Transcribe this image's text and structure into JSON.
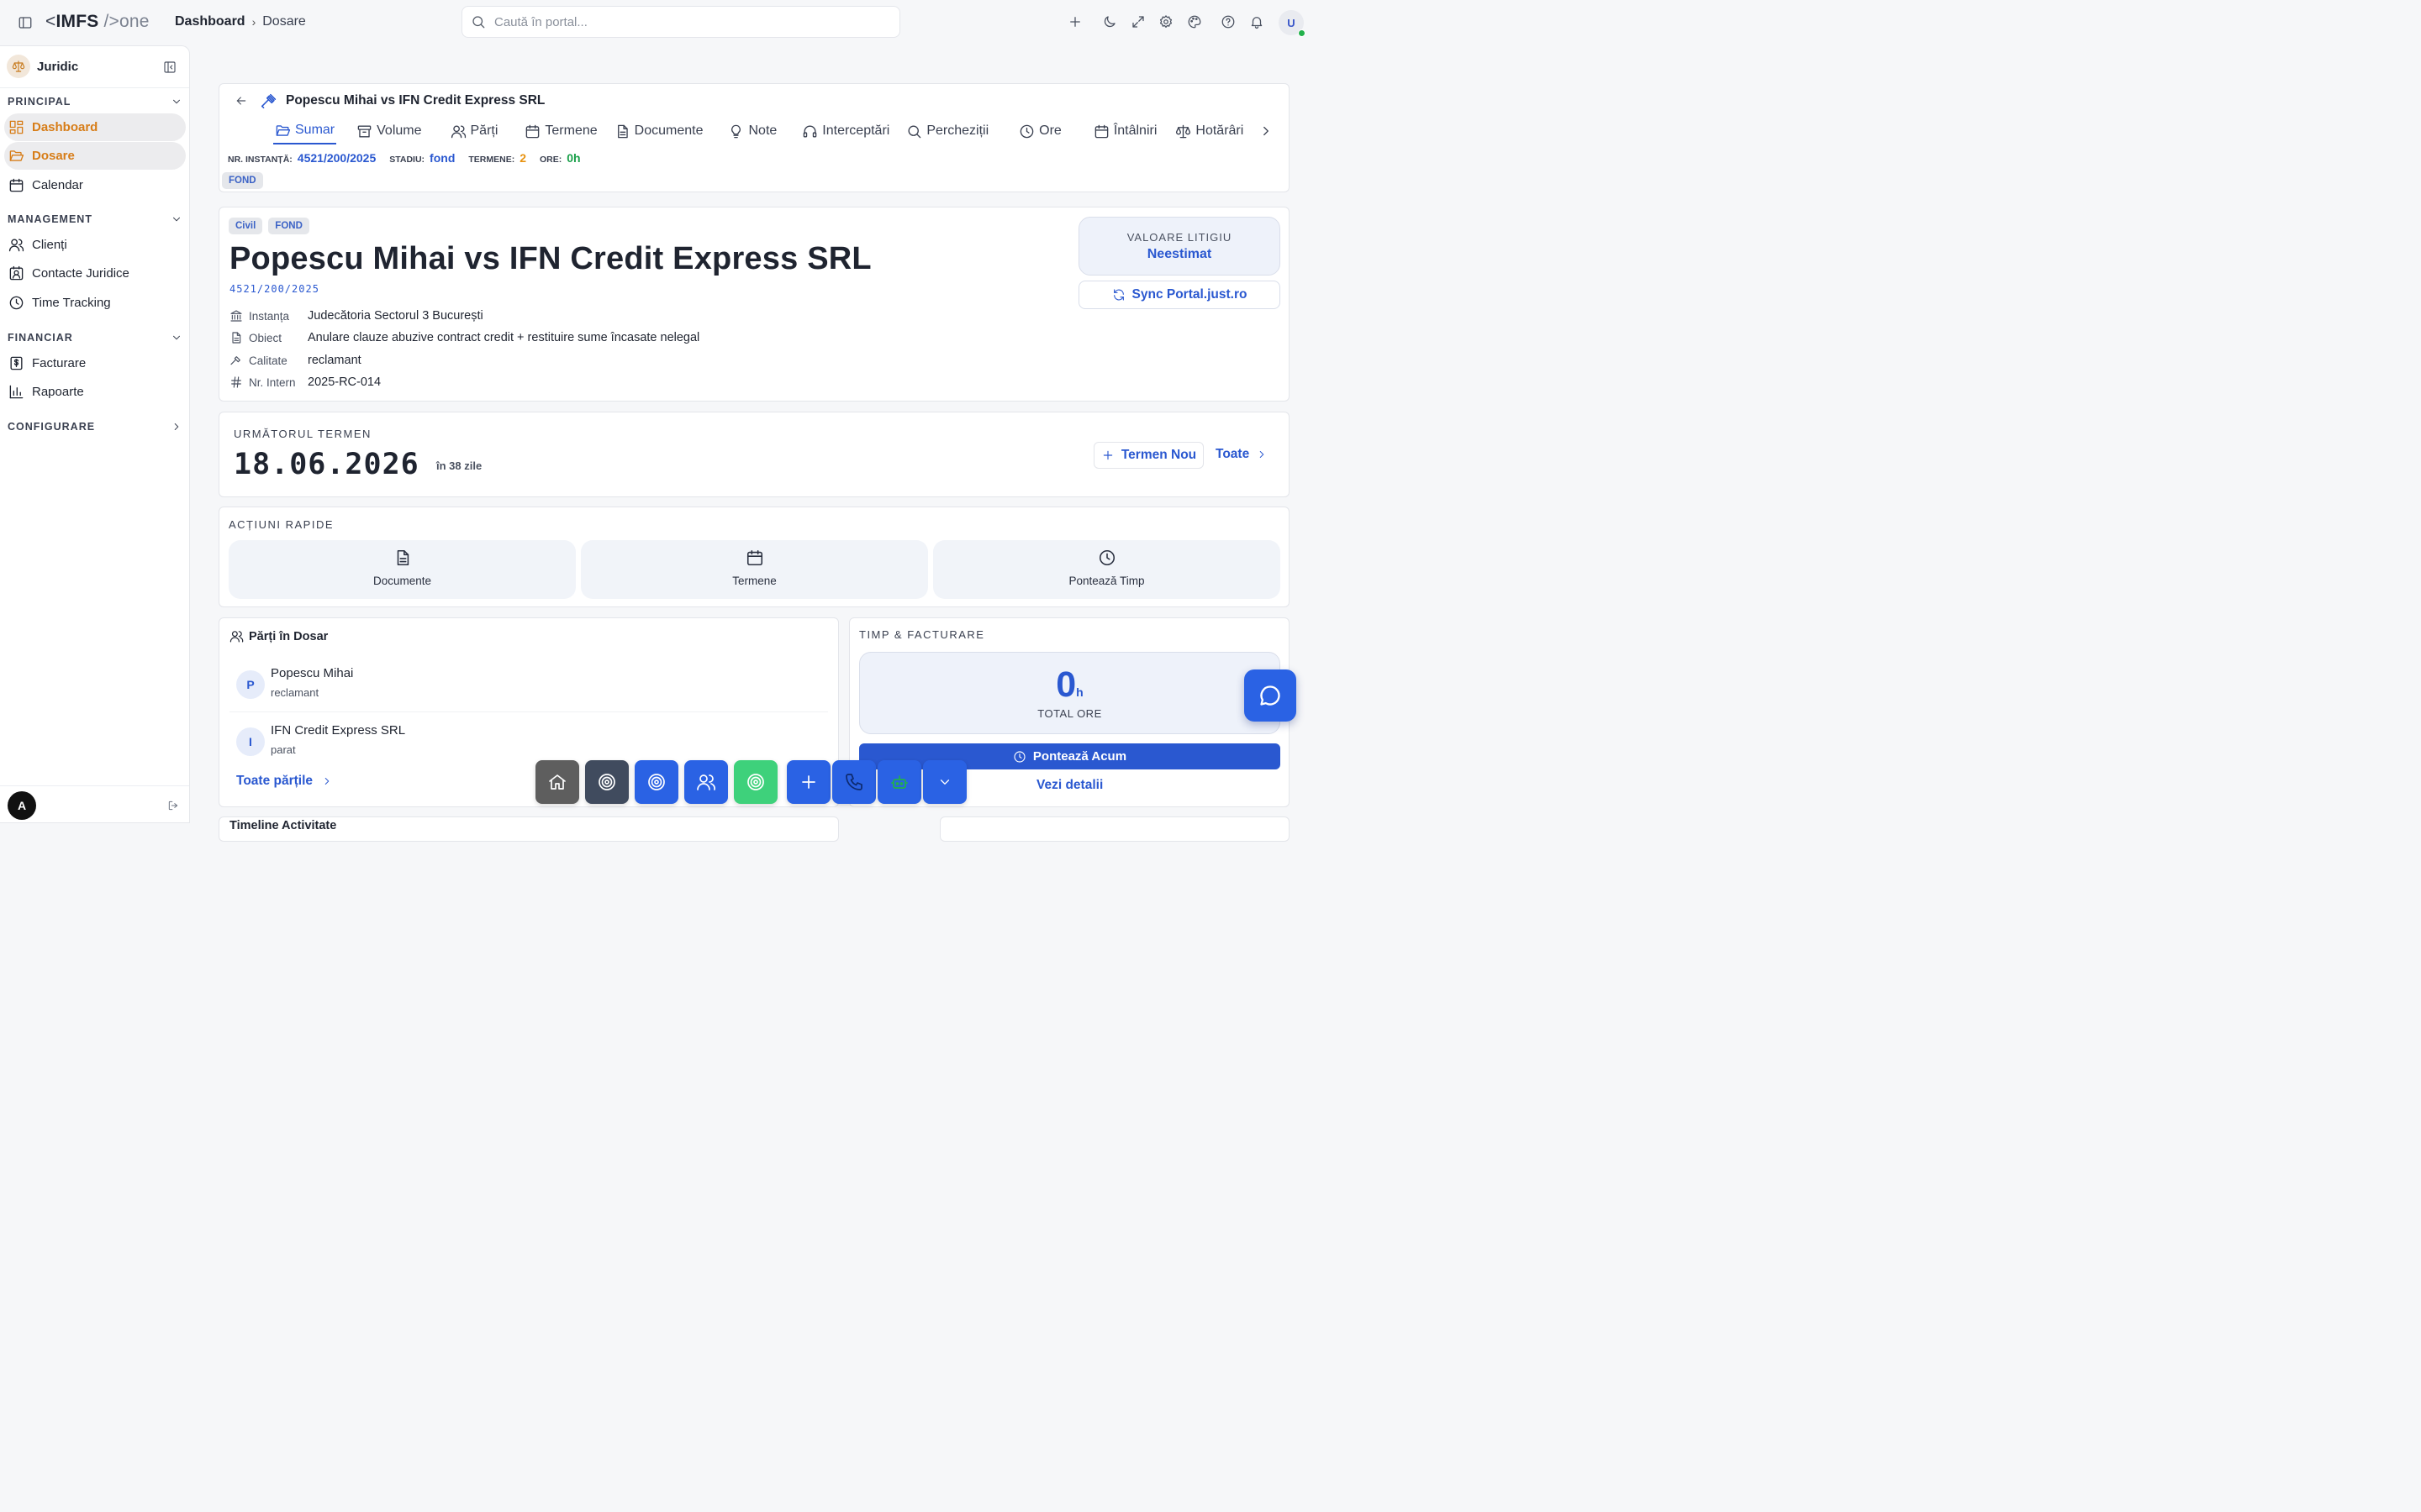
{
  "app": {
    "logo_lt": "<",
    "logo_name": "IMFS",
    "logo_slash": " />",
    "logo_suffix": "one"
  },
  "breadcrumb": {
    "root": "Dashboard",
    "current": "Dosare"
  },
  "search": {
    "placeholder": "Caută în portal..."
  },
  "user": {
    "initial": "U"
  },
  "sidebar": {
    "workspace": "Juridic",
    "sections": [
      {
        "title": "PRINCIPAL",
        "items": [
          {
            "label": "Dashboard"
          },
          {
            "label": "Dosare"
          },
          {
            "label": "Calendar"
          }
        ]
      },
      {
        "title": "MANAGEMENT",
        "items": [
          {
            "label": "Clienți"
          },
          {
            "label": "Contacte Juridice"
          },
          {
            "label": "Time Tracking"
          }
        ]
      },
      {
        "title": "FINANCIAR",
        "items": [
          {
            "label": "Facturare"
          },
          {
            "label": "Rapoarte"
          }
        ]
      },
      {
        "title": "CONFIGURARE",
        "items": []
      }
    ],
    "footer_avatar": "A"
  },
  "case_header": {
    "title": "Popescu Mihai vs IFN Credit Express SRL",
    "tabs": [
      "Sumar",
      "Volume",
      "Părți",
      "Termene",
      "Documente",
      "Note",
      "Interceptări",
      "Percheziții",
      "Ore",
      "Întâlniri",
      "Hotărâri"
    ],
    "meta": {
      "instance_label": "NR. INSTANȚĂ:",
      "instance_value": "4521/200/2025",
      "stage_label": "STADIU:",
      "stage_value": "fond",
      "hearings_label": "TERMENE:",
      "hearings_value": "2",
      "hours_label": "ORE:",
      "hours_value": "0h"
    },
    "stage_tag": "FOND"
  },
  "case": {
    "tags": [
      "Civil",
      "FOND"
    ],
    "title": "Popescu Mihai vs IFN Credit Express SRL",
    "number": "4521/200/2025",
    "fields": [
      {
        "key": "Instanța",
        "value": "Judecătoria Sectorul 3 București"
      },
      {
        "key": "Obiect",
        "value": "Anulare clauze abuzive contract credit + restituire sume încasate nelegal"
      },
      {
        "key": "Calitate",
        "value": "reclamant"
      },
      {
        "key": "Nr. Intern",
        "value": "2025-RC-014"
      }
    ],
    "value_label": "VALOARE LITIGIU",
    "value_amount": "Neestimat",
    "sync_label": "Sync Portal.just.ro"
  },
  "next_hearing": {
    "label": "URMĂTORUL TERMEN",
    "date": "18.06.2026",
    "in_days": "în 38 zile",
    "new_button": "Termen Nou",
    "all_link": "Toate"
  },
  "quick_actions": {
    "label": "ACȚIUNI RAPIDE",
    "items": [
      "Documente",
      "Termene",
      "Pontează Timp"
    ]
  },
  "parties": {
    "title": "Părți în Dosar",
    "items": [
      {
        "initial": "P",
        "name": "Popescu Mihai",
        "role": "reclamant"
      },
      {
        "initial": "I",
        "name": "IFN Credit Express SRL",
        "role": "parat"
      }
    ],
    "all_link": "Toate părțile"
  },
  "time_billing": {
    "label": "TIMP & FACTURARE",
    "hours": "0",
    "hours_unit": "h",
    "total_label": "TOTAL ORE",
    "log_button": "Pontează Acum",
    "details_link": "Vezi detalii"
  },
  "next_section": {
    "title": "Timeline Activitate"
  }
}
